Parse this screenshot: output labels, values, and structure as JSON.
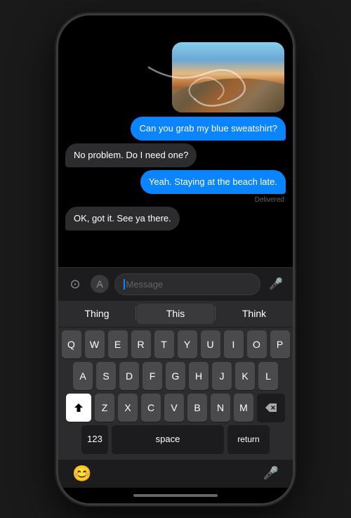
{
  "phone": {
    "messages": [
      {
        "id": 1,
        "text": "Can you grab my blue sweatshirt?",
        "side": "right",
        "type": "blue"
      },
      {
        "id": 2,
        "text": "No problem. Do I need one?",
        "side": "left",
        "type": "gray"
      },
      {
        "id": 3,
        "text": "Yeah. Staying at the beach late.",
        "side": "right",
        "type": "blue"
      },
      {
        "id": 4,
        "text": "OK, got it. See ya there.",
        "side": "left",
        "type": "gray"
      }
    ],
    "delivered_label": "Delivered",
    "input_placeholder": "Message",
    "autocorrect": {
      "left": "Thing",
      "center": "This",
      "right": "Think"
    },
    "keyboard": {
      "row1": [
        "Q",
        "W",
        "E",
        "R",
        "T",
        "Y",
        "U",
        "I",
        "O",
        "P"
      ],
      "row2": [
        "A",
        "S",
        "D",
        "F",
        "G",
        "H",
        "J",
        "K",
        "L"
      ],
      "row3": [
        "Z",
        "X",
        "C",
        "V",
        "B",
        "N",
        "M"
      ],
      "space_label": "space",
      "nums_label": "123",
      "return_label": "return"
    },
    "bottom_bar": {
      "emoji": "😊",
      "mic": "🎤"
    }
  }
}
